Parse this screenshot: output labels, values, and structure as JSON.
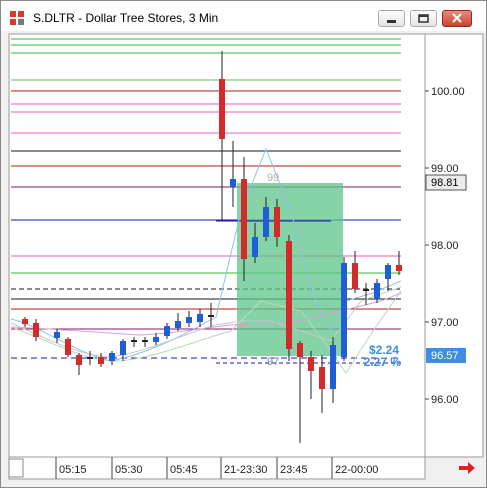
{
  "window": {
    "title": "S.DLTR - Dollar Tree Stores, 3 Min",
    "minimize_icon": "minimize-icon",
    "maximize_icon": "maximize-icon",
    "close_icon": "close-icon"
  },
  "price_axis": {
    "labels": [
      "100.00",
      "99.00",
      "98.00",
      "97.00",
      "96.00"
    ],
    "last_price_box": "98.81",
    "current_price_box": "96.57"
  },
  "time_axis": {
    "labels": [
      "05:15",
      "05:30",
      "05:45",
      "21-23:30",
      "23:45",
      "22-00:00"
    ]
  },
  "annotations": {
    "pct_top": "99",
    "pct_bottom": "97",
    "change_value": "$2.24",
    "change_pct": "2.27 %"
  },
  "scroll_arrow_icon": "right-arrow-icon",
  "colors": {
    "up_candle": "#1f5fd6",
    "down_candle": "#d42a2a",
    "measure_box": "#5cc48a",
    "change_text": "#3f8fe0",
    "current_price_bg": "#3f8fe0",
    "scroll_arrow": "#e02020"
  }
}
